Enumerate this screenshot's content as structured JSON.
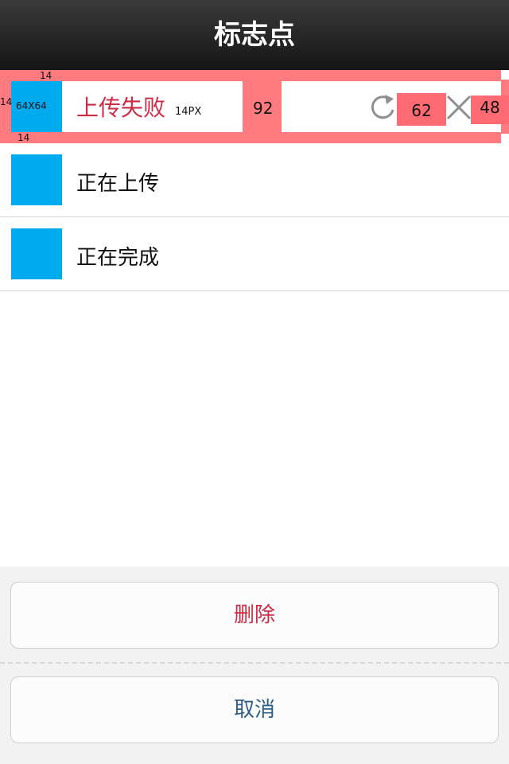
{
  "header": {
    "title": "标志点"
  },
  "annotated_row": {
    "title": "上传失败",
    "thumb_label": "64X64",
    "font_note": "14PX",
    "spacing_top": "14",
    "spacing_left": "14",
    "spacing_bottom": "14",
    "gap_label": "92",
    "retry_badge": "62",
    "close_badge": "48",
    "title_color": "#cc2a45"
  },
  "rows": [
    {
      "title": "正在上传"
    },
    {
      "title": "正在完成"
    }
  ],
  "sheet": {
    "delete_label": "删除",
    "cancel_label": "取消"
  },
  "icons": [
    "retry-icon",
    "close-icon"
  ]
}
